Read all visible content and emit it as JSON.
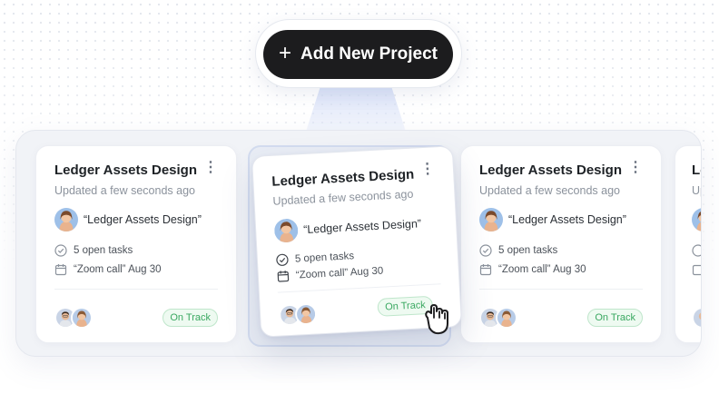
{
  "add_button": {
    "label": "Add New Project",
    "icon": "plus-icon"
  },
  "card": {
    "title": "Ledger Assets Design",
    "updated": "Updated a few seconds ago",
    "owner": "“Ledger Assets Design”",
    "open_tasks": "5 open tasks",
    "event": "“Zoom call” Aug 30",
    "status": "On Track",
    "menu_icon": "more-vertical-icon"
  },
  "partial_card": {
    "title": "Le",
    "updated": "Up"
  },
  "colors": {
    "button_bg": "#1c1c1e",
    "status_green": "#3aa861",
    "status_bg": "#eefaf1",
    "tray_bg": "#f1f3f7"
  }
}
